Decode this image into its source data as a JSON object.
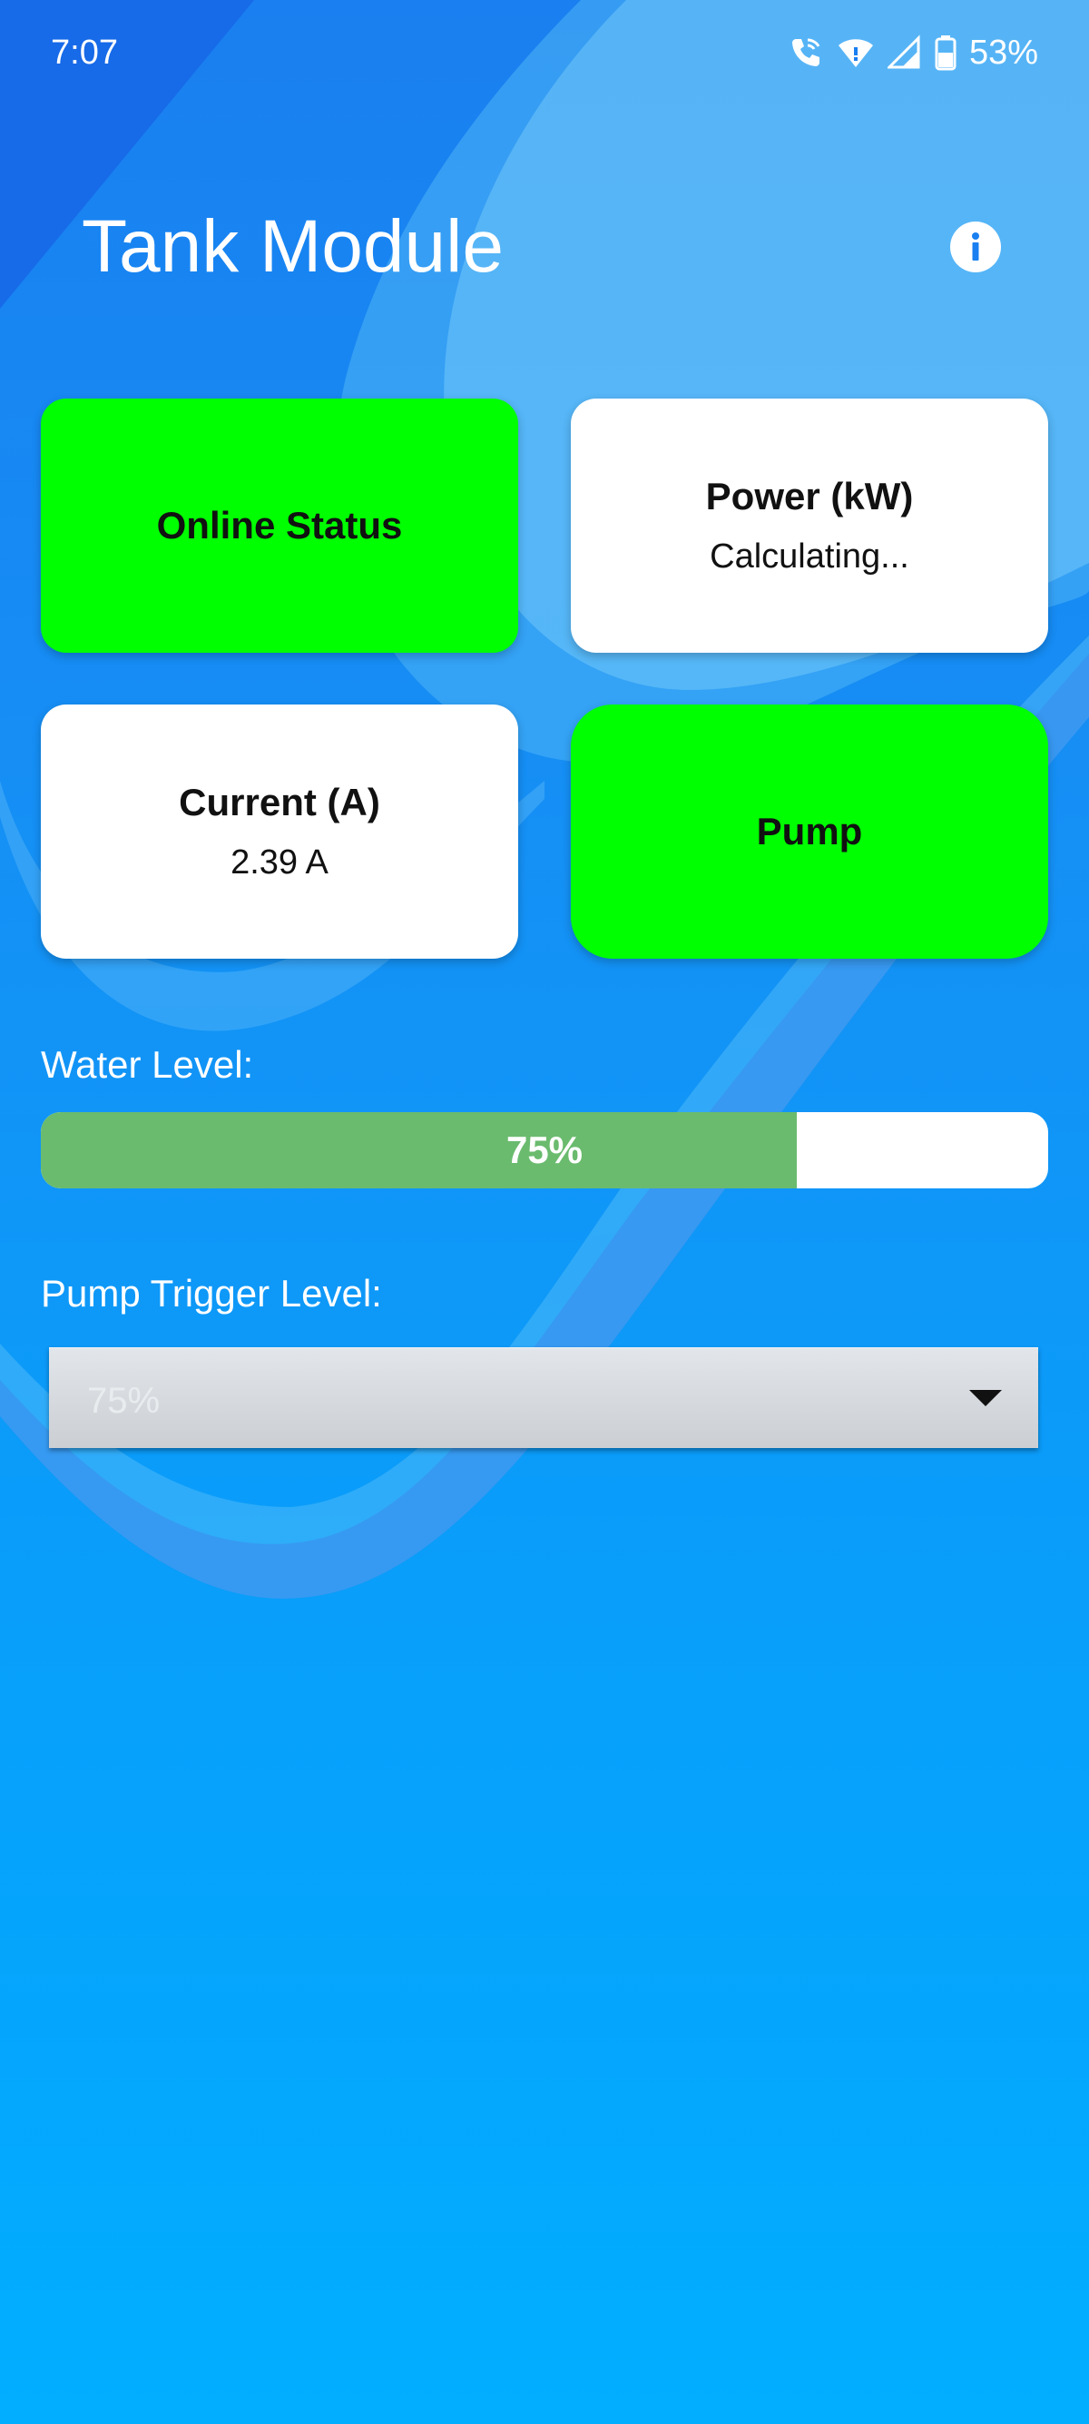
{
  "status_bar": {
    "time": "7:07",
    "battery_percent": "53%",
    "icons": [
      "wifi-calling-icon",
      "wifi-icon",
      "signal-icon",
      "battery-icon"
    ]
  },
  "app": {
    "title": "Tank Module",
    "info_icon": "info-icon"
  },
  "cards": {
    "online_status": {
      "title": "Online Status",
      "color": "#00ff00"
    },
    "power": {
      "title": "Power (kW)",
      "value": "Calculating...",
      "color": "#ffffff"
    },
    "current": {
      "title": "Current (A)",
      "value": "2.39 A",
      "color": "#ffffff"
    },
    "pump": {
      "title": "Pump",
      "color": "#00ff00"
    }
  },
  "water_level": {
    "label": "Water Level:",
    "percent": 75,
    "display": "75%",
    "fill_color": "#6abb6e"
  },
  "pump_trigger": {
    "label": "Pump Trigger Level:",
    "selected": "75%",
    "arrow_icon": "dropdown-arrow-icon"
  },
  "colors": {
    "background_top": "#1a7ff0",
    "background_bottom": "#01aeff",
    "status_green": "#00ff00"
  }
}
